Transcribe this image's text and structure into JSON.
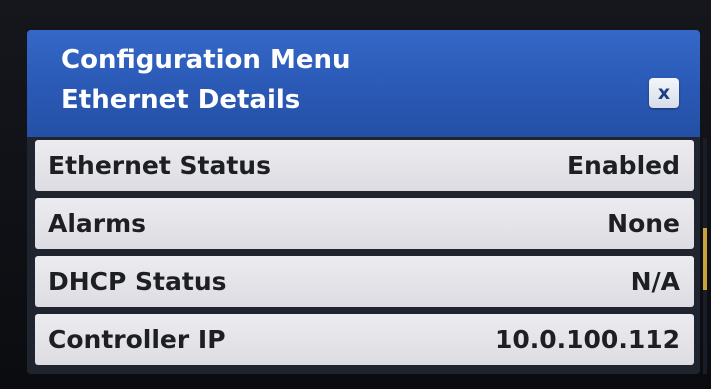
{
  "header": {
    "title": "Configuration Menu",
    "subtitle": "Ethernet Details",
    "close_label": "x"
  },
  "rows": [
    {
      "label": "Ethernet Status",
      "value": "Enabled"
    },
    {
      "label": "Alarms",
      "value": "None"
    },
    {
      "label": "DHCP Status",
      "value": "N/A"
    },
    {
      "label": "Controller IP",
      "value": "10.0.100.112"
    }
  ],
  "scrollbar": {
    "position_fraction": 0.38
  },
  "colors": {
    "header_blue": "#2a59b5",
    "row_background": "#e4e4e8",
    "text_dark": "#1d1f23",
    "scroll_thumb": "#c9a23a"
  }
}
